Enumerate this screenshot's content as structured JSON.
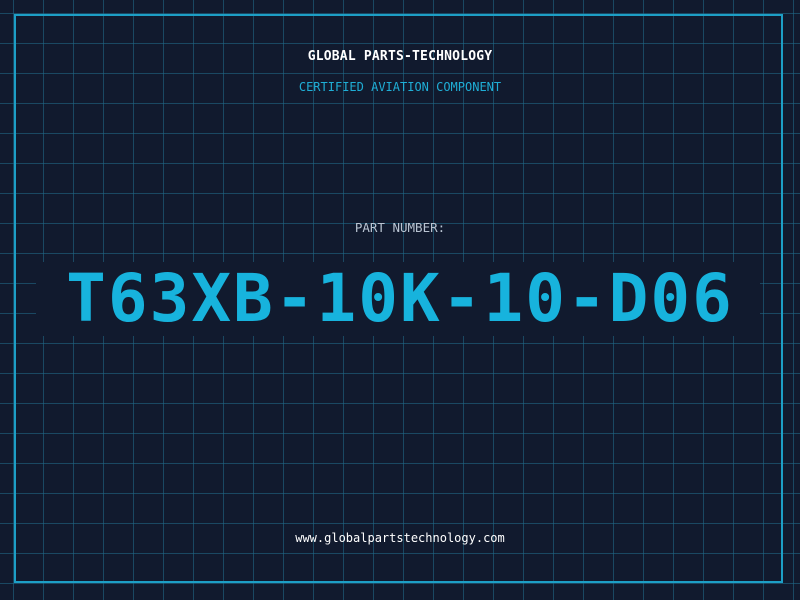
{
  "header": {
    "company": "GLOBAL PARTS-TECHNOLOGY",
    "subtitle": "CERTIFIED AVIATION COMPONENT"
  },
  "part": {
    "label": "PART NUMBER:",
    "number": "T63XB-10K-10-D06"
  },
  "footer": {
    "website": "www.globalpartstechnology.com"
  },
  "colors": {
    "background": "#111a2e",
    "grid": "#206e8c",
    "border": "#1d9fc6",
    "accent": "#17b3dd",
    "label": "#b9c4d2",
    "text": "#ffffff"
  }
}
